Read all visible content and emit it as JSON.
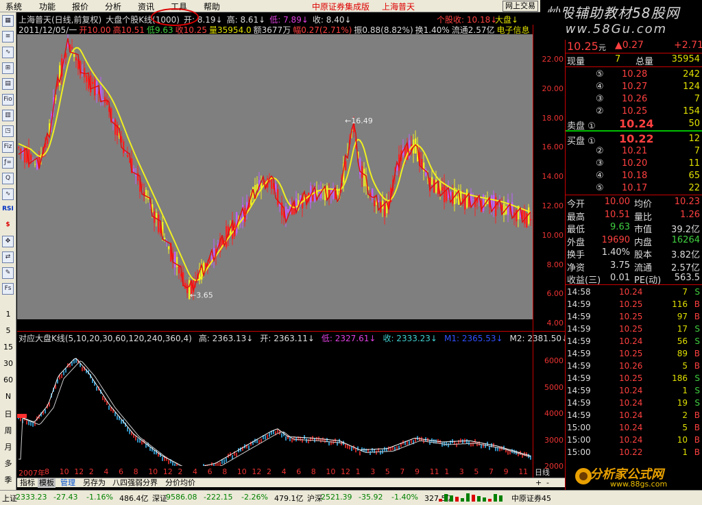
{
  "menubar": {
    "items": [
      "系统",
      "功能",
      "报价",
      "分析",
      "资讯",
      "工具",
      "帮助"
    ],
    "broker_title": "中原证券集成版",
    "stock_title": "上海普天",
    "trade_button": "网上交易"
  },
  "banner": {
    "title": "炒股辅助教材58股网",
    "url": "www.58Gu.com"
  },
  "left_toolbar": {
    "buttons": [
      "▦",
      "≡",
      "∿",
      "⊞",
      "▤",
      "Fio",
      "▥",
      "◳",
      "Fiz",
      "ƒ∞",
      "Q",
      "∿",
      "RSI",
      "$",
      "✥",
      "⇄",
      "✎",
      "Fs"
    ],
    "periods": [
      "1",
      "5",
      "15",
      "30",
      "60",
      "N",
      "日",
      "周",
      "月",
      "多",
      "季"
    ]
  },
  "upper_panel": {
    "line1_parts": [
      {
        "text": "上海普天(日线,前复权)",
        "color": "#dddddd"
      },
      {
        "text": "大盘个股K线(1000)",
        "color": "#dddddd"
      },
      {
        "text": "开: 8.19↓",
        "color": "#dddddd"
      },
      {
        "text": "高: 8.61↓",
        "color": "#dddddd"
      },
      {
        "text": "低: 7.89↓",
        "color": "#e040e0"
      },
      {
        "text": "收: 8.40↓",
        "color": "#dddddd"
      }
    ],
    "line1_right": "个股收: 10.18↓",
    "line1_right2": "大盘↓",
    "line2_parts": [
      {
        "text": "2011/12/05/一",
        "color": "#dddddd"
      },
      {
        "text": "开10.00",
        "color": "#ff4040"
      },
      {
        "text": "高10.51",
        "color": "#ff4040"
      },
      {
        "text": "低9.63",
        "color": "#40d040"
      },
      {
        "text": "收10.25",
        "color": "#ff4040"
      },
      {
        "text": "量35954.0",
        "color": "#e0e000"
      },
      {
        "text": "额3677万",
        "color": "#dddddd"
      },
      {
        "text": "幅0.27(2.71%)",
        "color": "#ff4040"
      },
      {
        "text": "振0.88(8.82%)",
        "color": "#dddddd"
      },
      {
        "text": "换1.40%",
        "color": "#dddddd"
      },
      {
        "text": "流通2.57亿",
        "color": "#dddddd"
      },
      {
        "text": "电子信息",
        "color": "#e0e000"
      }
    ],
    "high_label": "16.49",
    "low_label": "3.65"
  },
  "upper_yaxis": [
    "22.00",
    "20.00",
    "18.00",
    "16.00",
    "14.00",
    "12.00",
    "10.00",
    "8.00",
    "6.00",
    "4.00"
  ],
  "lower_panel": {
    "info_parts": [
      {
        "text": "对应大盘K线(5,10,20,30,60,120,240,360,4)",
        "color": "#dddddd"
      },
      {
        "text": "高: 2363.13↓",
        "color": "#dddddd"
      },
      {
        "text": "开: 2363.11↓",
        "color": "#dddddd"
      },
      {
        "text": "低: 2327.61↓",
        "color": "#e040e0"
      },
      {
        "text": "收: 2333.23↓",
        "color": "#40d0d0"
      },
      {
        "text": "M1: 2365.53↓",
        "color": "#3050ff"
      },
      {
        "text": "M2: 2381.50↓",
        "color": "#dddddd"
      }
    ]
  },
  "lower_yaxis": [
    "6000",
    "5000",
    "4000",
    "3000",
    "2000"
  ],
  "timeaxis": {
    "labels": [
      "2007年",
      "8",
      "10",
      "12",
      "2",
      "4",
      "6",
      "8",
      "10",
      "12",
      "2",
      "4",
      "6",
      "8",
      "10",
      "12",
      "2",
      "4",
      "6",
      "8",
      "10",
      "12",
      "1",
      "3",
      "5",
      "7",
      "9",
      "11",
      "1",
      "3",
      "5",
      "7",
      "9",
      "11"
    ],
    "dayline": "日线"
  },
  "tabs": [
    "指标",
    "模板",
    "管理",
    "另存为",
    "八四强弱分界",
    "分价均价"
  ],
  "quote": {
    "price": "10.25",
    "price_unit": "元",
    "change": "▲0.27",
    "change_pct": "+2.71",
    "vol_label": "现量",
    "vol_value": "7",
    "total_label": "总量",
    "total_value": "35954",
    "sells": [
      {
        "lvl": "⑤",
        "price": "10.28",
        "vol": "242"
      },
      {
        "lvl": "④",
        "price": "10.27",
        "vol": "124"
      },
      {
        "lvl": "③",
        "price": "10.26",
        "vol": "7"
      },
      {
        "lvl": "②",
        "price": "10.25",
        "vol": "154"
      },
      {
        "lvl": "卖盘 ①",
        "price": "10.24",
        "vol": "50"
      }
    ],
    "buys": [
      {
        "lvl": "买盘 ①",
        "price": "10.22",
        "vol": "12"
      },
      {
        "lvl": "②",
        "price": "10.21",
        "vol": "7"
      },
      {
        "lvl": "③",
        "price": "10.20",
        "vol": "11"
      },
      {
        "lvl": "④",
        "price": "10.18",
        "vol": "65"
      },
      {
        "lvl": "⑤",
        "price": "10.17",
        "vol": "22"
      }
    ],
    "stats": [
      {
        "l1": "今开",
        "v1": "10.00",
        "c1": "#ff4040",
        "l2": "均价",
        "v2": "10.23",
        "c2": "#ff4040"
      },
      {
        "l1": "最高",
        "v1": "10.51",
        "c1": "#ff4040",
        "l2": "量比",
        "v2": "1.26",
        "c2": "#ff4040"
      },
      {
        "l1": "最低",
        "v1": "9.63",
        "c1": "#40d040",
        "l2": "市值",
        "v2": "39.2亿",
        "c2": "#dddddd"
      },
      {
        "l1": "外盘",
        "v1": "19690",
        "c1": "#ff4040",
        "l2": "内盘",
        "v2": "16264",
        "c2": "#40d040"
      },
      {
        "l1": "换手",
        "v1": "1.40%",
        "c1": "#dddddd",
        "l2": "股本",
        "v2": "3.82亿",
        "c2": "#dddddd"
      },
      {
        "l1": "净资",
        "v1": "3.75",
        "c1": "#dddddd",
        "l2": "流通",
        "v2": "2.57亿",
        "c2": "#dddddd"
      },
      {
        "l1": "收益(三)",
        "v1": "0.01",
        "c1": "#dddddd",
        "l2": "PE(动)",
        "v2": "563.5",
        "c2": "#dddddd"
      }
    ],
    "ticks": [
      {
        "t": "14:58",
        "p": "10.24",
        "v": "7",
        "s": "S"
      },
      {
        "t": "14:59",
        "p": "10.25",
        "v": "116",
        "s": "B"
      },
      {
        "t": "14:59",
        "p": "10.25",
        "v": "97",
        "s": "B"
      },
      {
        "t": "14:59",
        "p": "10.25",
        "v": "17",
        "s": "S"
      },
      {
        "t": "14:59",
        "p": "10.24",
        "v": "56",
        "s": "S"
      },
      {
        "t": "14:59",
        "p": "10.25",
        "v": "89",
        "s": "B"
      },
      {
        "t": "14:59",
        "p": "10.26",
        "v": "5",
        "s": "B"
      },
      {
        "t": "14:59",
        "p": "10.25",
        "v": "186",
        "s": "S"
      },
      {
        "t": "14:59",
        "p": "10.24",
        "v": "1",
        "s": "S"
      },
      {
        "t": "14:59",
        "p": "10.24",
        "v": "19",
        "s": "S"
      },
      {
        "t": "14:59",
        "p": "10.24",
        "v": "2",
        "s": "B"
      },
      {
        "t": "15:00",
        "p": "10.24",
        "v": "5",
        "s": "B"
      },
      {
        "t": "15:00",
        "p": "10.24",
        "v": "10",
        "s": "B"
      },
      {
        "t": "15:00",
        "p": "10.22",
        "v": "1",
        "s": "B"
      }
    ]
  },
  "logo": {
    "title": "分析家公式网",
    "url": "www.88gs.com"
  },
  "statusbar": {
    "items": [
      {
        "text": "上证",
        "color": "#000000"
      },
      {
        "text": "2333.23",
        "color": "#008000"
      },
      {
        "text": "-27.43",
        "color": "#008000"
      },
      {
        "text": "-1.16%",
        "color": "#008000"
      },
      {
        "text": "486.4亿",
        "color": "#000000"
      },
      {
        "text": "深证",
        "color": "#000000"
      },
      {
        "text": "9586.08",
        "color": "#008000"
      },
      {
        "text": "-222.15",
        "color": "#008000"
      },
      {
        "text": "-2.26%",
        "color": "#008000"
      },
      {
        "text": "479.1亿",
        "color": "#000000"
      },
      {
        "text": "沪深",
        "color": "#000000"
      },
      {
        "text": "2521.39",
        "color": "#008000"
      },
      {
        "text": "-35.92",
        "color": "#008000"
      },
      {
        "text": "-1.40%",
        "color": "#008000"
      },
      {
        "text": "327.5亿",
        "color": "#000000"
      }
    ],
    "broker": "中原证券45"
  }
}
